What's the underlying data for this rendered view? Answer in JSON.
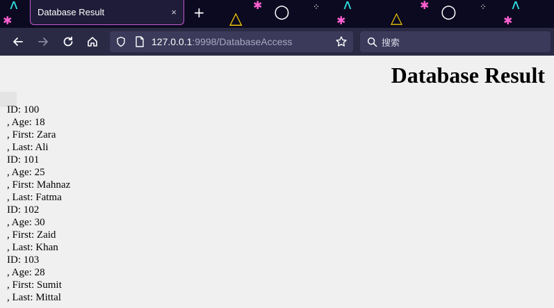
{
  "browser": {
    "tab_title": "Database Result",
    "tab_close": "×",
    "new_tab": "+",
    "url_host": "127.0.0.1",
    "url_rest": ":9998/DatabaseAccess",
    "search_placeholder": "搜索"
  },
  "page": {
    "title": "Database Result",
    "records": [
      {
        "id": "ID: 100",
        "age": ", Age: 18",
        "first": ", First: Zara",
        "last": ", Last: Ali"
      },
      {
        "id": "ID: 101",
        "age": ", Age: 25",
        "first": ", First: Mahnaz",
        "last": ", Last: Fatma"
      },
      {
        "id": "ID: 102",
        "age": ", Age: 30",
        "first": ", First: Zaid",
        "last": ", Last: Khan"
      },
      {
        "id": "ID: 103",
        "age": ", Age: 28",
        "first": ", First: Sumit",
        "last": ", Last: Mittal"
      }
    ]
  },
  "colors": {
    "tabbar_bg": "#0c0a20",
    "toolbar_bg": "#2b2a45",
    "page_bg": "#f0f0f0",
    "tab_border": "#c25ad0"
  }
}
